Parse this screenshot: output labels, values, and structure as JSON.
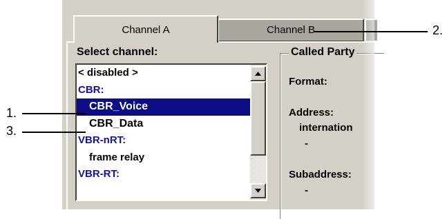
{
  "tabs": [
    {
      "label": "Channel A",
      "active": true
    },
    {
      "label": "Channel B",
      "active": false
    }
  ],
  "select_channel_label": "Select channel:",
  "channel_list": {
    "items": [
      {
        "label": "< disabled >",
        "kind": "option"
      },
      {
        "label": "CBR:",
        "kind": "category"
      },
      {
        "label": "CBR_Voice",
        "kind": "option",
        "selected": true
      },
      {
        "label": "CBR_Data",
        "kind": "option"
      },
      {
        "label": "VBR-nRT:",
        "kind": "category"
      },
      {
        "label": "frame relay",
        "kind": "option"
      },
      {
        "label": "VBR-RT:",
        "kind": "category"
      }
    ]
  },
  "called_party": {
    "title": "Called Party",
    "format_label": "Format:",
    "address_label": "Address:",
    "address_value": "internation",
    "address_dash": "-",
    "subaddress_label": "Subaddress:",
    "subaddress_dash": "-"
  },
  "callouts": [
    "1.",
    "2.",
    "3."
  ],
  "colors": {
    "dialog_bg": "#d4d0c8",
    "selection_bg": "#0c0c84",
    "category_text": "#12129a"
  }
}
